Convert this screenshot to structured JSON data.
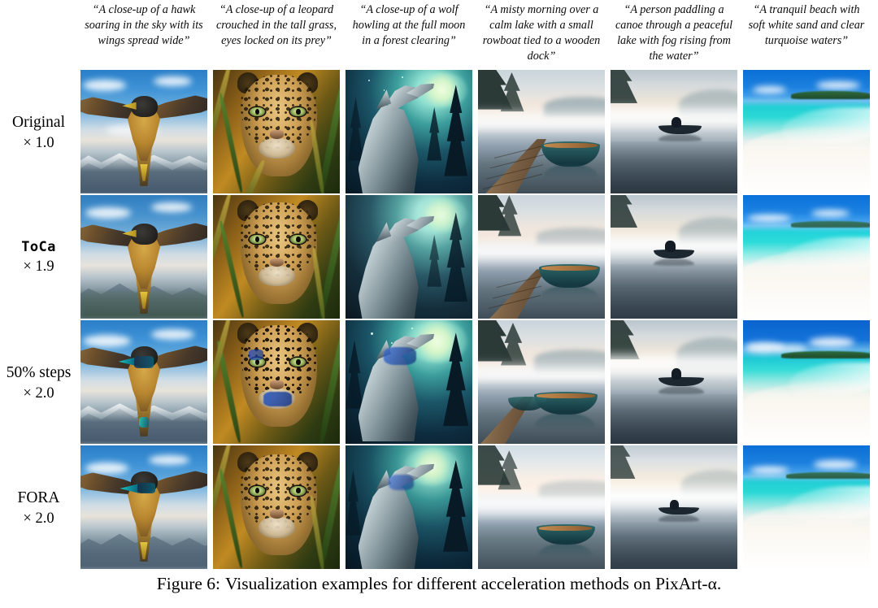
{
  "figure": {
    "caption_number": "Figure 6:",
    "caption_text": "Visualization examples for different acceleration methods on PixArt-α."
  },
  "columns": [
    {
      "id": "hawk",
      "prompt": "“A close-up of a hawk soaring in the sky with its wings spread wide”"
    },
    {
      "id": "leopard",
      "prompt": "“A close-up of a leopard crouched in the tall grass, eyes locked on its prey”"
    },
    {
      "id": "wolf",
      "prompt": "“A close-up of a wolf howling at the full moon in a forest clearing”"
    },
    {
      "id": "dock",
      "prompt": "“A misty morning over a calm lake with a small rowboat tied to a wooden dock”"
    },
    {
      "id": "canoe",
      "prompt": "“A person paddling a canoe through a peaceful lake with fog rising from the water”"
    },
    {
      "id": "beach",
      "prompt": "“A tranquil beach with soft white sand and clear turquoise waters”"
    }
  ],
  "rows": [
    {
      "id": "original",
      "method": "Original",
      "speedup": "× 1.0",
      "mono": false
    },
    {
      "id": "toca",
      "method": "ToCa",
      "speedup": "× 1.9",
      "mono": true
    },
    {
      "id": "fifty_steps",
      "method": "50% steps",
      "speedup": "× 2.0",
      "mono": false
    },
    {
      "id": "fora",
      "method": "FORA",
      "speedup": "× 2.0",
      "mono": false
    }
  ],
  "colors": {
    "hawk_sky": "#3f93d6",
    "leopard_gold": "#cfa055",
    "wolf_teal": "#3c9e9c",
    "lake_fog": "#f3e8de",
    "beach_turquoise": "#2ad8d6",
    "beach_sky": "#0a6fd6",
    "glitch_cyan": "#1ad0c6",
    "text": "#000000",
    "background": "#ffffff"
  }
}
